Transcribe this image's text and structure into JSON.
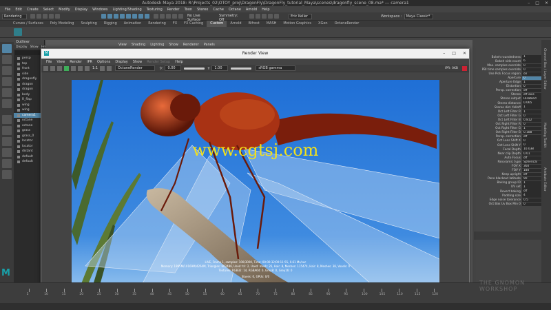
{
  "window": {
    "title": "Autodesk Maya 2018: R:\\Projects_02\\OTOY_proj\\DragonFly\\DragonFly_tutorial_Maya\\scenes\\dragonfly_scene_08.ma*  ---  camera1",
    "controls": [
      "–",
      "□",
      "✕"
    ]
  },
  "menubar": [
    "File",
    "Edit",
    "Create",
    "Select",
    "Modify",
    "Display",
    "Windows",
    "Lighting/Shading",
    "Texturing",
    "Render",
    "Toon",
    "Stereo",
    "Cache",
    "Octane",
    "Arnold",
    "Help"
  ],
  "statusline": {
    "mode": "Rendering",
    "live_surface": "No Live Surface",
    "symmetry": "Symmetry: Off",
    "user": "Eric Keller",
    "workspace_label": "Workspace :",
    "workspace": "Maya Classic*"
  },
  "shelf_tabs": [
    "Curves / Surfaces",
    "Poly Modeling",
    "Sculpting",
    "Rigging",
    "Animation",
    "Rendering",
    "FX",
    "FX Caching",
    "Custom",
    "Arnold",
    "Bifrost",
    "MASH",
    "Motion Graphics",
    "XGen",
    "OctaneRender"
  ],
  "shelf_active": "Custom",
  "outliner": {
    "title": "Outliner",
    "menu": [
      "Display",
      "Show",
      "Help"
    ],
    "items": [
      "persp",
      "top",
      "front",
      "side",
      "dragonfly",
      "dragon",
      "dragon",
      "body",
      "R_flap",
      "wing",
      "wing",
      "camera1",
      "octane",
      "octane",
      "grass",
      "grass_0",
      "locator",
      "locator",
      "distant",
      "default",
      "default"
    ],
    "selected_index": 11
  },
  "viewport_menu": [
    "View",
    "Shading",
    "Lighting",
    "Show",
    "Renderer",
    "Panels"
  ],
  "render_view": {
    "title": "Render View",
    "menu": [
      "File",
      "View",
      "Render",
      "IPR",
      "Options",
      "Display",
      "Show",
      "Render Setup",
      "Help"
    ],
    "renderer": "OctaneRender",
    "exposure": "0.00",
    "gamma": "1.00",
    "colorspace": "sRGB gamma",
    "size_label": "1:1",
    "ipr_label": "IPR: 0KB",
    "watermark": "www.cgtsj.com",
    "stats": [
      "LIVE, Frame 1, samples: 100/3000, Time: 00:00:32/00:11:55, 0.61 Ms/sec",
      "Memory: 1995M/10169M/4264M, Triangles: 602486, Used: tri: 2, Used: mesh: 26, Hair: 8, Meshes: 115474, Hair: 8, Meshes: 38, Voxels: 0",
      "Textures: RGB32: 14, RGBA64: 0, Grey8: 0, Grey16: 0",
      "Slaves: 0, GPUs: 0/0"
    ]
  },
  "attributes": [
    {
      "label": "Bokeh roundedness",
      "value": "1"
    },
    {
      "label": "Bokeh side count",
      "value": "6"
    },
    {
      "label": "Max. samples override",
      "value": "0"
    },
    {
      "label": "PBI time samples override",
      "value": "0"
    },
    {
      "label": "Use Pick Focus region",
      "value": "on"
    },
    {
      "label": "Aperture",
      "value": "0",
      "hl": true
    },
    {
      "label": "Aperture Edge",
      "value": "1"
    },
    {
      "label": "Distortion",
      "value": "0"
    },
    {
      "label": "Persp. correction",
      "value": "off"
    },
    {
      "label": "Stereo",
      "value": "off-axis"
    },
    {
      "label": "Stereo output",
      "value": "Disabled"
    },
    {
      "label": "Stereo distance",
      "value": "0.065"
    },
    {
      "label": "Stereo dist. falloff",
      "value": "1"
    },
    {
      "label": "Oct Left Filter R",
      "value": "1"
    },
    {
      "label": "Oct Left Filter G",
      "value": "0"
    },
    {
      "label": "Oct Left Filter B",
      "value": "0.812"
    },
    {
      "label": "Oct Right Filter R",
      "value": "0"
    },
    {
      "label": "Oct Right Filter G",
      "value": "1"
    },
    {
      "label": "Oct Right Filter B",
      "value": "0.188"
    },
    {
      "label": "Persp. correction",
      "value": "off"
    },
    {
      "label": "Oct Lens Shift X",
      "value": "0"
    },
    {
      "label": "Oct Lens Shift Y",
      "value": "0"
    },
    {
      "label": "Focal Depth",
      "value": "10.038"
    },
    {
      "label": "Near clip Depth",
      "value": "0.01"
    },
    {
      "label": "Auto Focus",
      "value": "off"
    },
    {
      "label": "Panoramic type",
      "value": "Spherical"
    },
    {
      "label": "FOV X",
      "value": "360"
    },
    {
      "label": "FOV Y",
      "value": "180"
    },
    {
      "label": "Keep upright",
      "value": "off"
    },
    {
      "label": "Pano blackout latitude",
      "value": "90"
    },
    {
      "label": "Baking group ID",
      "value": "1"
    },
    {
      "label": "UV set",
      "value": "1"
    },
    {
      "label": "Revert baking",
      "value": "off"
    },
    {
      "label": "Padding size",
      "value": "4"
    },
    {
      "label": "Edge noise tolerance",
      "value": "0.5"
    },
    {
      "label": "Oct Bak Uv Box Min 0",
      "value": "0"
    }
  ],
  "side_tabs": [
    "Channel Box / Layer Editor",
    "Modeling Toolkit",
    "Attribute Editor"
  ],
  "timeline": {
    "ticks": [
      "5",
      "10",
      "15",
      "20",
      "25",
      "30",
      "35",
      "40",
      "45",
      "50",
      "55",
      "60",
      "65",
      "70",
      "75",
      "80",
      "85",
      "90",
      "95",
      "100",
      "105",
      "110",
      "115",
      "120"
    ]
  },
  "watermark_brand": "THE GNOMON WORKSHOP",
  "colors": {
    "accent": "#5285a6",
    "sky_top": "#1f6fd6",
    "sky_bottom": "#6aa9e8",
    "dragonfly_red": "#a83214",
    "watermark": "#f4e11a"
  }
}
